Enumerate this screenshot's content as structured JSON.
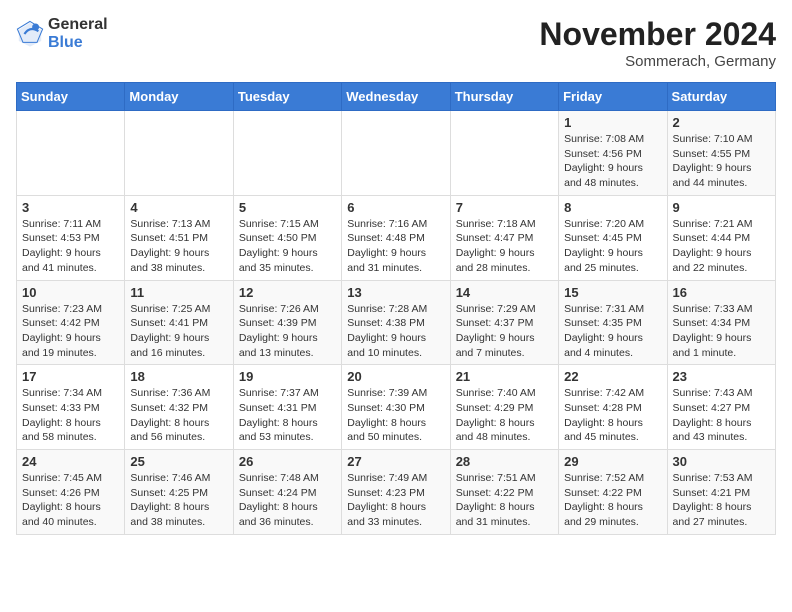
{
  "logo": {
    "general": "General",
    "blue": "Blue"
  },
  "title": "November 2024",
  "subtitle": "Sommerach, Germany",
  "days_of_week": [
    "Sunday",
    "Monday",
    "Tuesday",
    "Wednesday",
    "Thursday",
    "Friday",
    "Saturday"
  ],
  "weeks": [
    [
      {
        "day": "",
        "info": ""
      },
      {
        "day": "",
        "info": ""
      },
      {
        "day": "",
        "info": ""
      },
      {
        "day": "",
        "info": ""
      },
      {
        "day": "",
        "info": ""
      },
      {
        "day": "1",
        "info": "Sunrise: 7:08 AM\nSunset: 4:56 PM\nDaylight: 9 hours and 48 minutes."
      },
      {
        "day": "2",
        "info": "Sunrise: 7:10 AM\nSunset: 4:55 PM\nDaylight: 9 hours and 44 minutes."
      }
    ],
    [
      {
        "day": "3",
        "info": "Sunrise: 7:11 AM\nSunset: 4:53 PM\nDaylight: 9 hours and 41 minutes."
      },
      {
        "day": "4",
        "info": "Sunrise: 7:13 AM\nSunset: 4:51 PM\nDaylight: 9 hours and 38 minutes."
      },
      {
        "day": "5",
        "info": "Sunrise: 7:15 AM\nSunset: 4:50 PM\nDaylight: 9 hours and 35 minutes."
      },
      {
        "day": "6",
        "info": "Sunrise: 7:16 AM\nSunset: 4:48 PM\nDaylight: 9 hours and 31 minutes."
      },
      {
        "day": "7",
        "info": "Sunrise: 7:18 AM\nSunset: 4:47 PM\nDaylight: 9 hours and 28 minutes."
      },
      {
        "day": "8",
        "info": "Sunrise: 7:20 AM\nSunset: 4:45 PM\nDaylight: 9 hours and 25 minutes."
      },
      {
        "day": "9",
        "info": "Sunrise: 7:21 AM\nSunset: 4:44 PM\nDaylight: 9 hours and 22 minutes."
      }
    ],
    [
      {
        "day": "10",
        "info": "Sunrise: 7:23 AM\nSunset: 4:42 PM\nDaylight: 9 hours and 19 minutes."
      },
      {
        "day": "11",
        "info": "Sunrise: 7:25 AM\nSunset: 4:41 PM\nDaylight: 9 hours and 16 minutes."
      },
      {
        "day": "12",
        "info": "Sunrise: 7:26 AM\nSunset: 4:39 PM\nDaylight: 9 hours and 13 minutes."
      },
      {
        "day": "13",
        "info": "Sunrise: 7:28 AM\nSunset: 4:38 PM\nDaylight: 9 hours and 10 minutes."
      },
      {
        "day": "14",
        "info": "Sunrise: 7:29 AM\nSunset: 4:37 PM\nDaylight: 9 hours and 7 minutes."
      },
      {
        "day": "15",
        "info": "Sunrise: 7:31 AM\nSunset: 4:35 PM\nDaylight: 9 hours and 4 minutes."
      },
      {
        "day": "16",
        "info": "Sunrise: 7:33 AM\nSunset: 4:34 PM\nDaylight: 9 hours and 1 minute."
      }
    ],
    [
      {
        "day": "17",
        "info": "Sunrise: 7:34 AM\nSunset: 4:33 PM\nDaylight: 8 hours and 58 minutes."
      },
      {
        "day": "18",
        "info": "Sunrise: 7:36 AM\nSunset: 4:32 PM\nDaylight: 8 hours and 56 minutes."
      },
      {
        "day": "19",
        "info": "Sunrise: 7:37 AM\nSunset: 4:31 PM\nDaylight: 8 hours and 53 minutes."
      },
      {
        "day": "20",
        "info": "Sunrise: 7:39 AM\nSunset: 4:30 PM\nDaylight: 8 hours and 50 minutes."
      },
      {
        "day": "21",
        "info": "Sunrise: 7:40 AM\nSunset: 4:29 PM\nDaylight: 8 hours and 48 minutes."
      },
      {
        "day": "22",
        "info": "Sunrise: 7:42 AM\nSunset: 4:28 PM\nDaylight: 8 hours and 45 minutes."
      },
      {
        "day": "23",
        "info": "Sunrise: 7:43 AM\nSunset: 4:27 PM\nDaylight: 8 hours and 43 minutes."
      }
    ],
    [
      {
        "day": "24",
        "info": "Sunrise: 7:45 AM\nSunset: 4:26 PM\nDaylight: 8 hours and 40 minutes."
      },
      {
        "day": "25",
        "info": "Sunrise: 7:46 AM\nSunset: 4:25 PM\nDaylight: 8 hours and 38 minutes."
      },
      {
        "day": "26",
        "info": "Sunrise: 7:48 AM\nSunset: 4:24 PM\nDaylight: 8 hours and 36 minutes."
      },
      {
        "day": "27",
        "info": "Sunrise: 7:49 AM\nSunset: 4:23 PM\nDaylight: 8 hours and 33 minutes."
      },
      {
        "day": "28",
        "info": "Sunrise: 7:51 AM\nSunset: 4:22 PM\nDaylight: 8 hours and 31 minutes."
      },
      {
        "day": "29",
        "info": "Sunrise: 7:52 AM\nSunset: 4:22 PM\nDaylight: 8 hours and 29 minutes."
      },
      {
        "day": "30",
        "info": "Sunrise: 7:53 AM\nSunset: 4:21 PM\nDaylight: 8 hours and 27 minutes."
      }
    ]
  ]
}
